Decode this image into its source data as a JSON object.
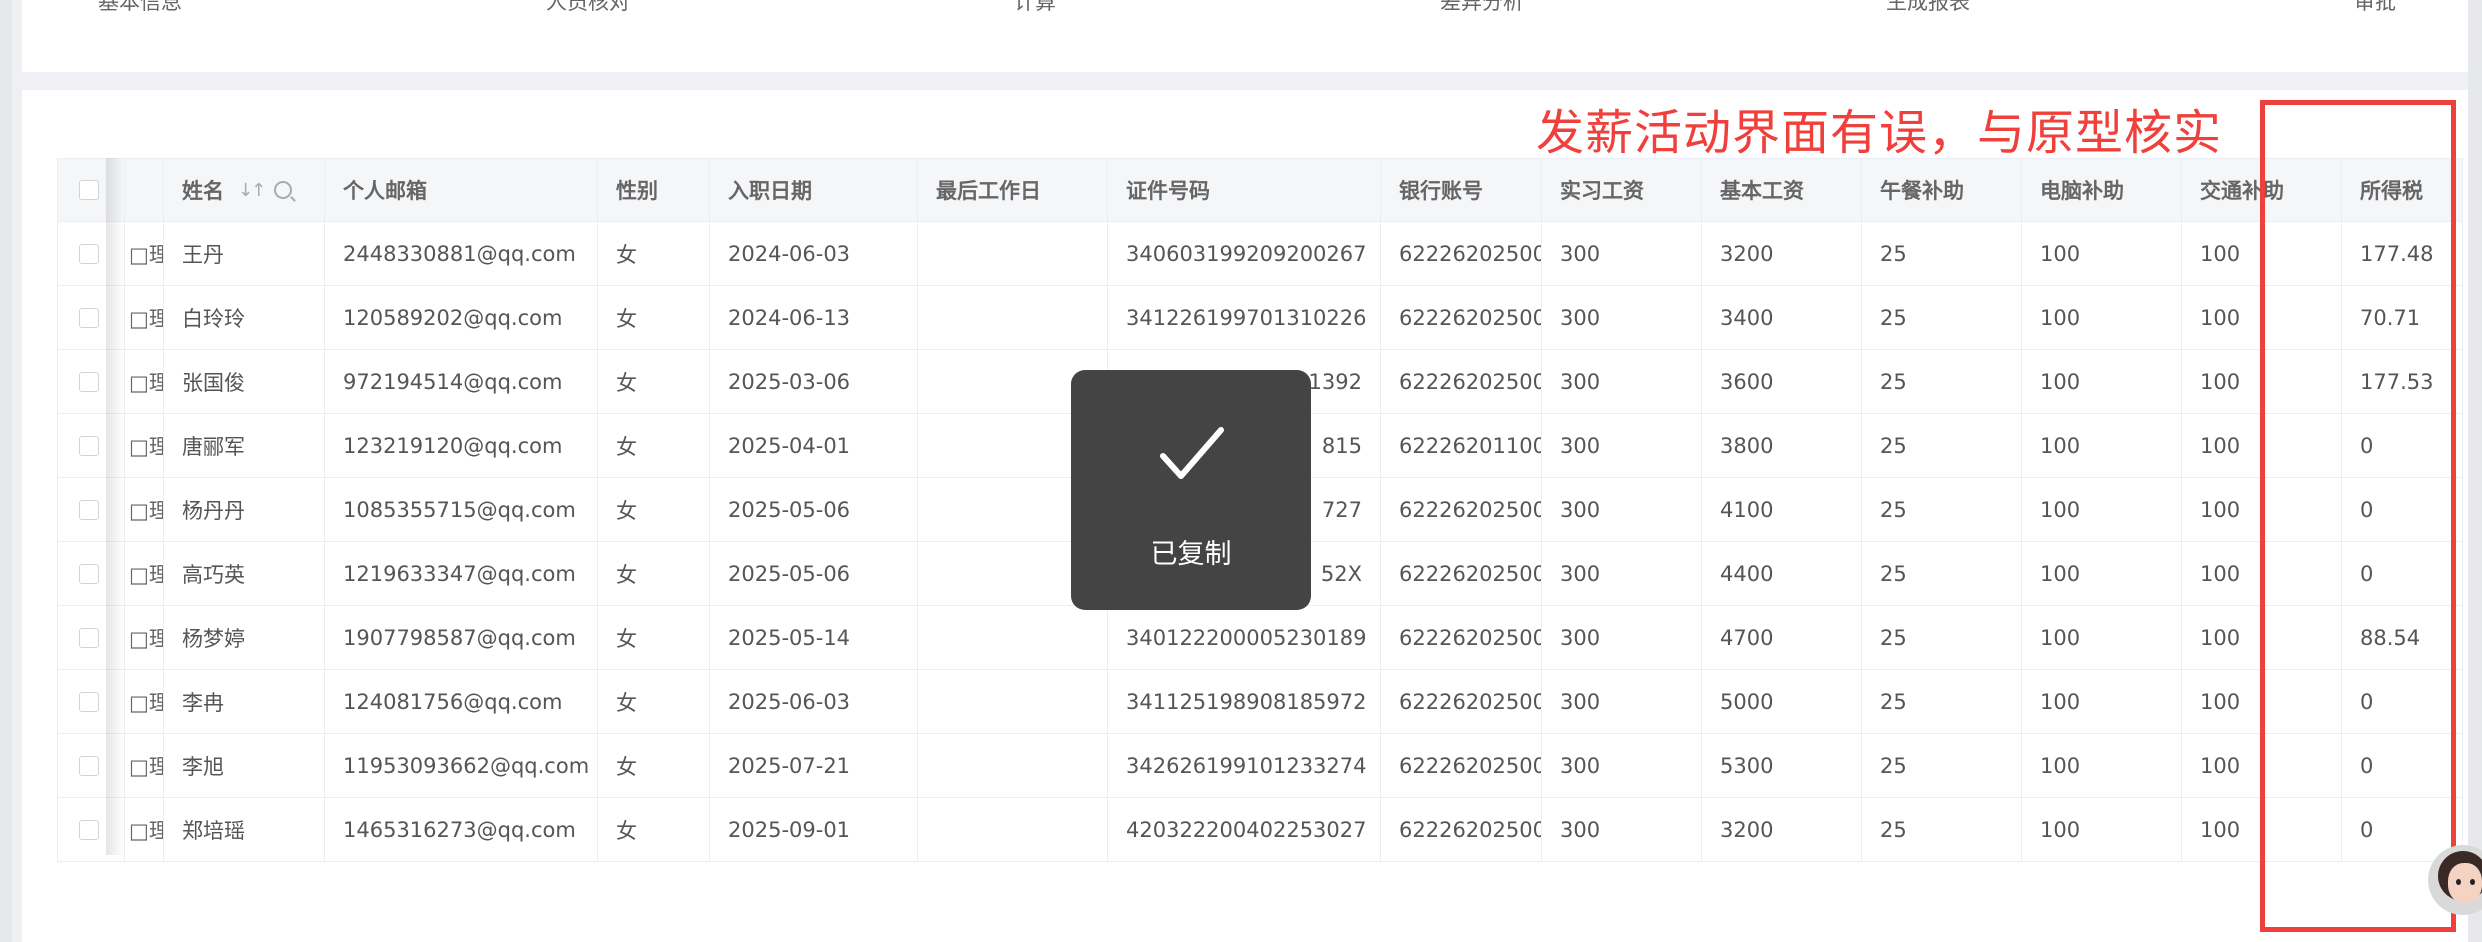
{
  "steps": [
    "基本信息",
    "人员核对",
    "计算",
    "差异分析",
    "生成报表",
    "审批"
  ],
  "annotation": {
    "text": "发薪活动界面有误，与原型核实",
    "color": "#f0403c"
  },
  "toast": {
    "text": "已复制"
  },
  "table": {
    "dept_fragment": "□理部",
    "columns": [
      "姓名",
      "个人邮箱",
      "性别",
      "入职日期",
      "最后工作日",
      "证件号码",
      "银行账号",
      "实习工资",
      "基本工资",
      "午餐补助",
      "电脑补助",
      "交通补助",
      "所得税"
    ],
    "rows": [
      [
        "王丹",
        "2448330881@qq.com",
        "女",
        "2024-06-03",
        "",
        "340603199209200267",
        "62226202500",
        "300",
        "3200",
        "25",
        "100",
        "100",
        "177.48"
      ],
      [
        "白玲玲",
        "120589202@qq.com",
        "女",
        "2024-06-13",
        "",
        "341226199701310226",
        "62226202500",
        "300",
        "3400",
        "25",
        "100",
        "100",
        "70.71"
      ],
      [
        "张国俊",
        "972194514@qq.com",
        "女",
        "2025-03-06",
        "",
        "1392",
        "62226202500",
        "300",
        "3600",
        "25",
        "100",
        "100",
        "177.53"
      ],
      [
        "唐郦军",
        "123219120@qq.com",
        "女",
        "2025-04-01",
        "",
        "815",
        "62226201100",
        "300",
        "3800",
        "25",
        "100",
        "100",
        "0"
      ],
      [
        "杨丹丹",
        "1085355715@qq.com",
        "女",
        "2025-05-06",
        "",
        "727",
        "62226202500",
        "300",
        "4100",
        "25",
        "100",
        "100",
        "0"
      ],
      [
        "高巧英",
        "1219633347@qq.com",
        "女",
        "2025-05-06",
        "",
        "52X",
        "62226202500",
        "300",
        "4400",
        "25",
        "100",
        "100",
        "0"
      ],
      [
        "杨梦婷",
        "1907798587@qq.com",
        "女",
        "2025-05-14",
        "",
        "340122200005230189",
        "62226202500",
        "300",
        "4700",
        "25",
        "100",
        "100",
        "88.54"
      ],
      [
        "李冉",
        "124081756@qq.com",
        "女",
        "2025-06-03",
        "",
        "341125198908185972",
        "62226202500",
        "300",
        "5000",
        "25",
        "100",
        "100",
        "0"
      ],
      [
        "李旭",
        "11953093662@qq.com",
        "女",
        "2025-07-21",
        "",
        "342626199101233274",
        "62226202500",
        "300",
        "5300",
        "25",
        "100",
        "100",
        "0"
      ],
      [
        "郑培瑶",
        "1465316273@qq.com",
        "女",
        "2025-09-01",
        "",
        "420322200402253027",
        "62226202500",
        "300",
        "3200",
        "25",
        "100",
        "100",
        "0"
      ]
    ]
  }
}
